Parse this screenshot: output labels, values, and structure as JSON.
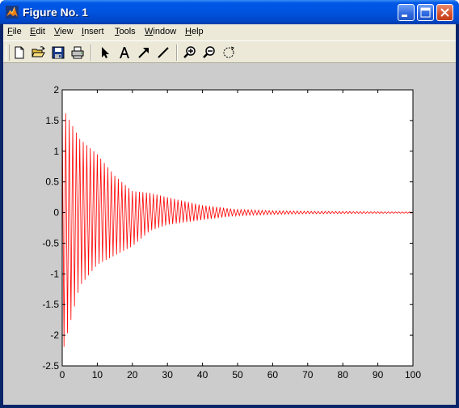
{
  "window": {
    "title": "Figure No. 1",
    "icon": "matlab-icon",
    "controls": [
      "minimize-icon",
      "maximize-icon",
      "close-icon"
    ]
  },
  "menu": {
    "items": [
      {
        "label": "File",
        "mnemonic": "F",
        "rest": "ile"
      },
      {
        "label": "Edit",
        "mnemonic": "E",
        "rest": "dit"
      },
      {
        "label": "View",
        "mnemonic": "V",
        "rest": "iew"
      },
      {
        "label": "Insert",
        "mnemonic": "I",
        "rest": "nsert"
      },
      {
        "label": "Tools",
        "mnemonic": "T",
        "rest": "ools"
      },
      {
        "label": "Window",
        "mnemonic": "W",
        "rest": "indow"
      },
      {
        "label": "Help",
        "mnemonic": "H",
        "rest": "elp"
      }
    ]
  },
  "toolbar": {
    "tools": [
      "new-file-icon",
      "open-folder-icon",
      "save-icon",
      "print-icon",
      "select-arrow-icon",
      "insert-text-icon",
      "insert-arrow-icon",
      "insert-line-icon",
      "zoom-in-icon",
      "zoom-out-icon",
      "rotate-3d-icon"
    ]
  },
  "chart_data": {
    "type": "line",
    "title": "",
    "xlabel": "",
    "ylabel": "",
    "xlim": [
      0,
      100
    ],
    "ylim": [
      -2.5,
      2
    ],
    "xticks": [
      0,
      10,
      20,
      30,
      40,
      50,
      60,
      70,
      80,
      90,
      100
    ],
    "yticks": [
      2,
      1.5,
      1,
      0.5,
      0,
      -0.5,
      -1,
      -1.5,
      -2,
      -2.5
    ],
    "xtick_labels": [
      "0",
      "10",
      "20",
      "30",
      "40",
      "50",
      "60",
      "70",
      "80",
      "90",
      "100"
    ],
    "ytick_labels": [
      "2",
      "1.5",
      "1",
      "0.5",
      "0",
      "-0.5",
      "-1",
      "-1.5",
      "-2",
      "-2.5"
    ],
    "grid": false,
    "series": [
      {
        "color": "#ff0000",
        "description": "damped oscillation decaying to 0",
        "envelope_points": [
          {
            "x": 0,
            "max": 1.72,
            "min": -2.3
          },
          {
            "x": 5,
            "max": 1.2,
            "min": -1.2
          },
          {
            "x": 10,
            "max": 0.95,
            "min": -0.85
          },
          {
            "x": 15,
            "max": 0.6,
            "min": -0.7
          },
          {
            "x": 20,
            "max": 0.35,
            "min": -0.55
          },
          {
            "x": 25,
            "max": 0.32,
            "min": -0.3
          },
          {
            "x": 30,
            "max": 0.25,
            "min": -0.2
          },
          {
            "x": 40,
            "max": 0.12,
            "min": -0.12
          },
          {
            "x": 50,
            "max": 0.05,
            "min": -0.05
          },
          {
            "x": 60,
            "max": 0.03,
            "min": -0.03
          },
          {
            "x": 70,
            "max": 0.02,
            "min": -0.02
          },
          {
            "x": 100,
            "max": 0.01,
            "min": -0.01
          }
        ],
        "oscillation_period": 1
      }
    ]
  }
}
